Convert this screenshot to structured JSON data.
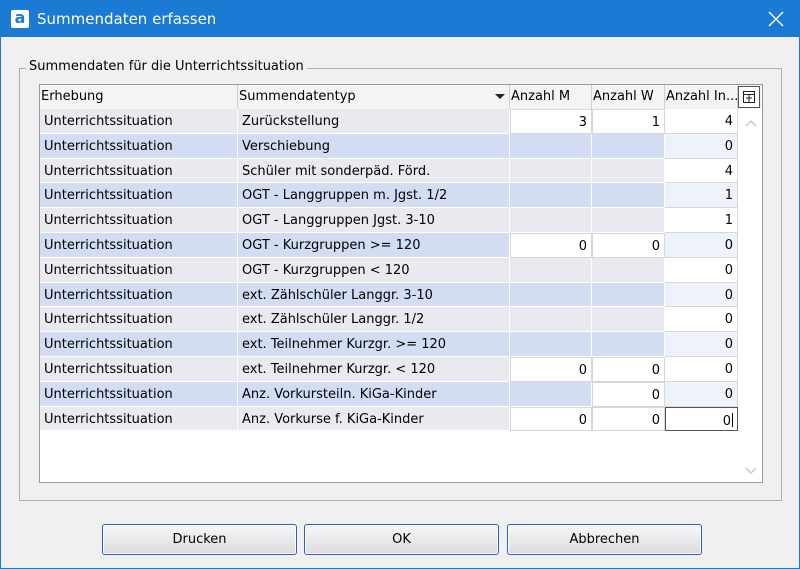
{
  "window": {
    "title": "Summendaten erfassen",
    "app_icon": "a"
  },
  "group": {
    "label": "Summendaten für die Unterrichtssituation"
  },
  "grid": {
    "columns": [
      "Erhebung",
      "Summendatentyp",
      "Anzahl M",
      "Anzahl W",
      "Anzahl In..."
    ],
    "rows": [
      {
        "erhebung": "Unterrichtssituation",
        "typ": "Zurückstellung",
        "m": "3",
        "w": "1",
        "total": "4"
      },
      {
        "erhebung": "Unterrichtssituation",
        "typ": "Verschiebung",
        "m": "",
        "w": "",
        "total": "0"
      },
      {
        "erhebung": "Unterrichtssituation",
        "typ": "Schüler mit sonderpäd. Förd.",
        "m": "",
        "w": "",
        "total": "4"
      },
      {
        "erhebung": "Unterrichtssituation",
        "typ": "OGT - Langgruppen m. Jgst. 1/2",
        "m": "",
        "w": "",
        "total": "1"
      },
      {
        "erhebung": "Unterrichtssituation",
        "typ": "OGT - Langgruppen Jgst. 3-10",
        "m": "",
        "w": "",
        "total": "1"
      },
      {
        "erhebung": "Unterrichtssituation",
        "typ": "OGT - Kurzgruppen >= 120",
        "m": "0",
        "w": "0",
        "total": "0"
      },
      {
        "erhebung": "Unterrichtssituation",
        "typ": "OGT - Kurzgruppen < 120",
        "m": "",
        "w": "",
        "total": "0"
      },
      {
        "erhebung": "Unterrichtssituation",
        "typ": "ext. Zählschüler Langgr. 3-10",
        "m": "",
        "w": "",
        "total": "0"
      },
      {
        "erhebung": "Unterrichtssituation",
        "typ": "ext. Zählschüler Langgr. 1/2",
        "m": "",
        "w": "",
        "total": "0"
      },
      {
        "erhebung": "Unterrichtssituation",
        "typ": "ext. Teilnehmer Kurzgr. >= 120",
        "m": "",
        "w": "",
        "total": "0"
      },
      {
        "erhebung": "Unterrichtssituation",
        "typ": "ext. Teilnehmer Kurzgr. < 120",
        "m": "0",
        "w": "0",
        "total": "0"
      },
      {
        "erhebung": "Unterrichtssituation",
        "typ": "Anz. Vorkursteiln. KiGa-Kinder",
        "m": "",
        "w": "0",
        "total": "0"
      },
      {
        "erhebung": "Unterrichtssituation",
        "typ": "Anz. Vorkurse f. KiGa-Kinder",
        "m": "0",
        "w": "0",
        "total": "0"
      }
    ]
  },
  "buttons": {
    "print": "Drucken",
    "ok": "OK",
    "cancel": "Abbrechen"
  },
  "colors": {
    "titlebar": "#1a7ad4",
    "row_alt": "#d2ddf3",
    "row_base": "#e9e9ef",
    "button_border": "#2b5dd0"
  }
}
